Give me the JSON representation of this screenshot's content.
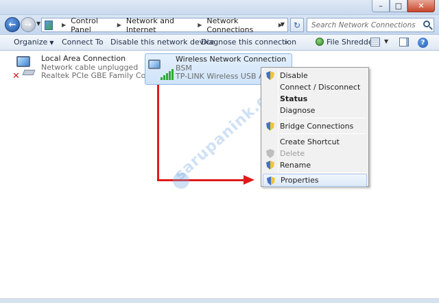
{
  "window": {
    "minimize_glyph": "–",
    "maximize_glyph": "□",
    "close_glyph": "✕"
  },
  "nav": {
    "breadcrumb": [
      "Control Panel",
      "Network and Internet",
      "Network Connections"
    ],
    "search_placeholder": "Search Network Connections"
  },
  "toolbar": {
    "organize_label": "Organize",
    "connect_label": "Connect To",
    "disable_label": "Disable this network device",
    "diagnose_label": "Diagnose this connection",
    "more_label": "»",
    "shredder_label": "File Shredder",
    "help_glyph": "?"
  },
  "connections": [
    {
      "name": "Local Area Connection",
      "status": "Network cable unplugged",
      "adapter": "Realtek PCIe GBE Family Controller"
    },
    {
      "name": "Wireless Network Connection",
      "status": "BSM",
      "adapter": "TP-LINK Wireless USB Adapter"
    }
  ],
  "context_menu": {
    "items": [
      {
        "label": "Disable"
      },
      {
        "label": "Connect / Disconnect"
      },
      {
        "label": "Status"
      },
      {
        "label": "Diagnose"
      },
      {
        "label": "Bridge Connections"
      },
      {
        "label": "Create Shortcut"
      },
      {
        "label": "Delete"
      },
      {
        "label": "Rename"
      },
      {
        "label": "Properties"
      }
    ]
  },
  "watermark": "sarupanink.com",
  "colors": {
    "annotation_arrow": "#e01a1a",
    "selection": "#cfe3f9",
    "menu_background": "#f1f1f1"
  }
}
